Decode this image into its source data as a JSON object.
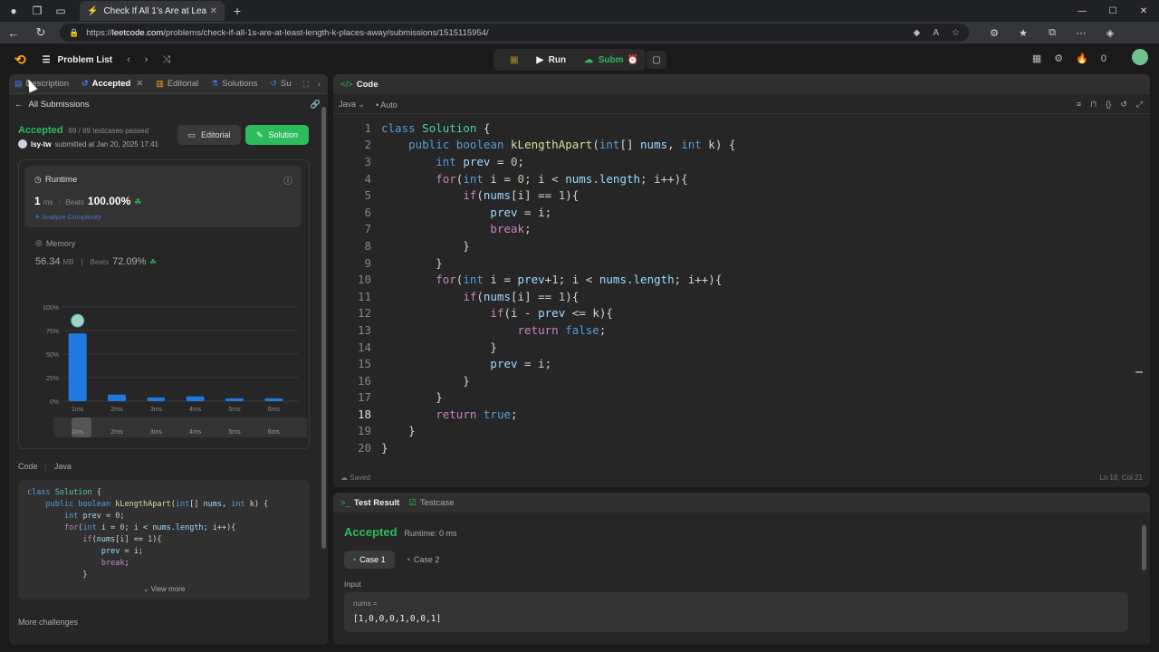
{
  "browser": {
    "tab_title": "Check If All 1's Are at Least Length",
    "url_host": "leetcode.com",
    "url_prefix": "https://",
    "url_path": "/problems/check-if-all-1s-are-at-least-length-k-places-away/submissions/1515115954/"
  },
  "header": {
    "problem_list": "Problem List",
    "run": "Run",
    "submit": "Submit",
    "points": "0"
  },
  "left_tabs": {
    "description": "Description",
    "accepted": "Accepted",
    "editorial": "Editorial",
    "solutions": "Solutions",
    "submissions": "Su"
  },
  "submission": {
    "all_submissions": "All Submissions",
    "status": "Accepted",
    "testcases": "69 / 69 testcases passed",
    "user": "lsy-tw",
    "submitted_at": "submitted at Jan 20, 2025 17:41",
    "editorial_btn": "Editorial",
    "solution_btn": "Solution"
  },
  "runtime": {
    "label": "Runtime",
    "value": "1",
    "unit": "ms",
    "beats_label": "Beats",
    "beats_pct": "100.00%",
    "analyze": "Analyze Complexity"
  },
  "memory": {
    "label": "Memory",
    "value": "56.34",
    "unit": "MB",
    "beats_label": "Beats",
    "beats_pct": "72.09%"
  },
  "chart_data": {
    "type": "bar",
    "categories": [
      "1ms",
      "2ms",
      "3ms",
      "4ms",
      "5ms",
      "6ms"
    ],
    "values": [
      72,
      7,
      4,
      5,
      3,
      3
    ],
    "ylim": [
      0,
      100
    ],
    "yticks": [
      "0%",
      "25%",
      "50%",
      "75%",
      "100%"
    ],
    "range_labels": [
      "1ms",
      "2ms",
      "3ms",
      "4ms",
      "5ms",
      "6ms"
    ],
    "highlight_index": 0,
    "bar_color": "#1f7ae0"
  },
  "code_preview": {
    "label": "Code",
    "language": "Java",
    "view_more": "View more",
    "lines": [
      "class Solution {",
      "    public boolean kLengthApart(int[] nums, int k) {",
      "        int prev = 0;",
      "        for(int i = 0; i < nums.length; i++){",
      "            if(nums[i] == 1){",
      "                prev = i;",
      "                break;",
      "            }"
    ]
  },
  "more_challenges": "More challenges",
  "editor": {
    "title": "Code",
    "language": "Java",
    "mode": "Auto",
    "saved": "Saved",
    "position": "Ln 18, Col 21",
    "current_line": 18
  },
  "test": {
    "tab_result": "Test Result",
    "tab_testcase": "Testcase",
    "status": "Accepted",
    "runtime": "Runtime: 0 ms",
    "case1": "Case 1",
    "case2": "Case 2",
    "input_label": "Input",
    "input_key": "nums =",
    "input_value": "[1,0,0,0,1,0,0,1]"
  },
  "colors": {
    "accent_green": "#2cbb5d",
    "brand_orange": "#ffa116",
    "bar_blue": "#1f7ae0"
  }
}
